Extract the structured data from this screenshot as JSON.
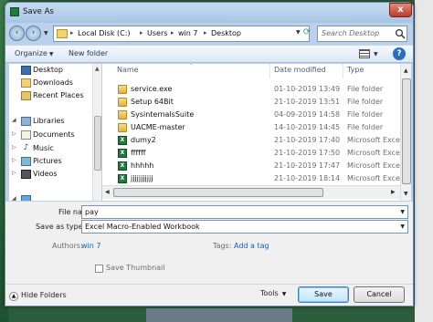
{
  "window": {
    "title": "Save As",
    "close_label": "x"
  },
  "address": {
    "crumbs": [
      "Local Disk (C:)",
      "Users",
      "win 7",
      "Desktop"
    ],
    "separator": "▸",
    "search_placeholder": "Search Desktop"
  },
  "toolbar": {
    "organize_label": "Organize",
    "new_folder_label": "New folder"
  },
  "nav_pane": {
    "items": [
      {
        "label": "Desktop",
        "icon": "desktop-icon"
      },
      {
        "label": "Downloads",
        "icon": "downloads-icon"
      },
      {
        "label": "Recent Places",
        "icon": "recent-places-icon"
      },
      {
        "label": "Libraries",
        "icon": "libraries-icon"
      },
      {
        "label": "Documents",
        "icon": "documents-icon"
      },
      {
        "label": "Music",
        "icon": "music-icon"
      },
      {
        "label": "Pictures",
        "icon": "pictures-icon"
      },
      {
        "label": "Videos",
        "icon": "videos-icon"
      }
    ]
  },
  "file_list": {
    "columns": [
      "Name",
      "Date modified",
      "Type"
    ],
    "rows": [
      {
        "name": "service.exe",
        "date": "01-10-2019 13:49",
        "type": "File folder",
        "kind": "folder"
      },
      {
        "name": "Setup 64Bit",
        "date": "21-10-2019 13:51",
        "type": "File folder",
        "kind": "folder"
      },
      {
        "name": "SysinternalsSuite",
        "date": "04-09-2019 14:58",
        "type": "File folder",
        "kind": "folder"
      },
      {
        "name": "UACME-master",
        "date": "14-10-2019 14:45",
        "type": "File folder",
        "kind": "folder"
      },
      {
        "name": "dumy2",
        "date": "21-10-2019 17:40",
        "type": "Microsoft Excel M...",
        "kind": "excel"
      },
      {
        "name": "ffffff",
        "date": "21-10-2019 17:50",
        "type": "Microsoft Excel M...",
        "kind": "excel"
      },
      {
        "name": "hhhhh",
        "date": "21-10-2019 17:47",
        "type": "Microsoft Excel M...",
        "kind": "excel"
      },
      {
        "name": "jjjjjjjjjjj",
        "date": "21-10-2019 18:14",
        "type": "Microsoft Excel M...",
        "kind": "excel"
      }
    ]
  },
  "form": {
    "file_name_label": "File name:",
    "file_name_value": "pay",
    "save_type_label": "Save as type:",
    "save_type_value": "Excel Macro-Enabled Workbook",
    "authors_label": "Authors:",
    "authors_value": "win 7",
    "tags_label": "Tags:",
    "tags_value": "Add a tag",
    "thumbnail_label": "Save Thumbnail"
  },
  "footer": {
    "hide_folders_label": "Hide Folders",
    "tools_label": "Tools",
    "save_label": "Save",
    "cancel_label": "Cancel"
  }
}
